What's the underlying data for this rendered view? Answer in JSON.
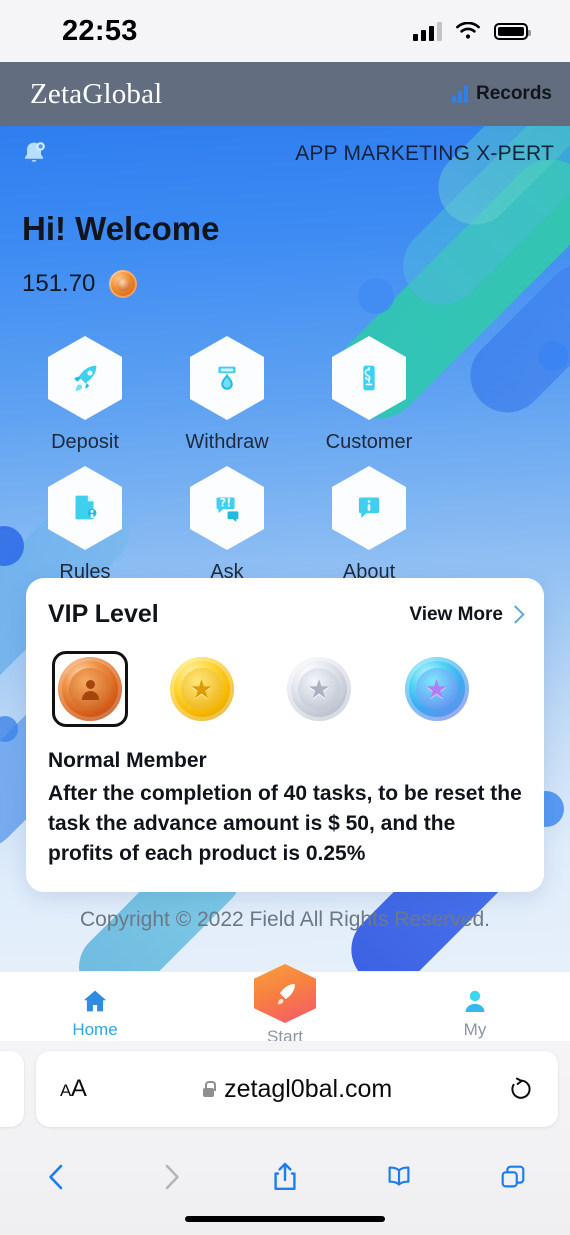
{
  "status_bar": {
    "time": "22:53",
    "signal_icon": "cellular-bars-icon",
    "wifi_icon": "wifi-icon",
    "battery_icon": "battery-full-icon"
  },
  "navbar": {
    "brand": "ZetaGlobal",
    "records_label": "Records",
    "records_icon": "bar-chart-icon",
    "bg_color": "#626e80"
  },
  "app_header": {
    "bell_icon": "notification-bell-icon",
    "tagline": "APP MARKETING X-PERT"
  },
  "account": {
    "greeting": "Hi! Welcome",
    "balance": "151.70",
    "coin_icon": "coin-icon"
  },
  "quick_actions": [
    {
      "label": "Deposit",
      "icon": "rocket-icon"
    },
    {
      "label": "Withdraw",
      "icon": "withdraw-icon"
    },
    {
      "label": "Customer",
      "icon": "customer-service-icon"
    },
    {
      "label": "Rules",
      "icon": "rules-document-icon"
    },
    {
      "label": "Ask",
      "icon": "ask-question-icon"
    },
    {
      "label": "About",
      "icon": "info-icon"
    }
  ],
  "vip": {
    "title": "VIP Level",
    "view_more_label": "View More",
    "view_more_icon": "chevron-right-icon",
    "badges": [
      {
        "name": "bronze-member-badge",
        "tier": "Bronze",
        "selected": true
      },
      {
        "name": "gold-member-badge",
        "tier": "Gold",
        "selected": false
      },
      {
        "name": "silver-member-badge",
        "tier": "Silver",
        "selected": false
      },
      {
        "name": "platinum-member-badge",
        "tier": "Platinum",
        "selected": false
      }
    ],
    "tier_name": "Normal Member",
    "description": "After the completion of 40 tasks, to be reset the task the advance amount is $ 50, and the profits of each product is 0.25%"
  },
  "footer": {
    "copyright": "Copyright © 2022 Field All Rights Reserved."
  },
  "tabbar": [
    {
      "label": "Home",
      "icon": "home-icon",
      "active": true
    },
    {
      "label": "Start",
      "icon": "rocket-icon",
      "active": false
    },
    {
      "label": "My",
      "icon": "person-icon",
      "active": false
    }
  ],
  "browser": {
    "text_size_label": "AA",
    "lock_icon": "lock-icon",
    "url": "zetagl0bal.com",
    "reload_icon": "reload-icon",
    "toolbar": [
      {
        "name": "back-button",
        "icon": "chevron-left-icon",
        "enabled": true
      },
      {
        "name": "forward-button",
        "icon": "chevron-right-icon",
        "enabled": false
      },
      {
        "name": "share-button",
        "icon": "share-icon",
        "enabled": true
      },
      {
        "name": "bookmarks-button",
        "icon": "book-icon",
        "enabled": true
      },
      {
        "name": "tabs-button",
        "icon": "tabs-icon",
        "enabled": true
      }
    ]
  },
  "colors": {
    "accent": "#2aa8e8",
    "brand_blue": "#2f7ef0",
    "navbar": "#626e80",
    "cta_orange": "#f8823f"
  }
}
